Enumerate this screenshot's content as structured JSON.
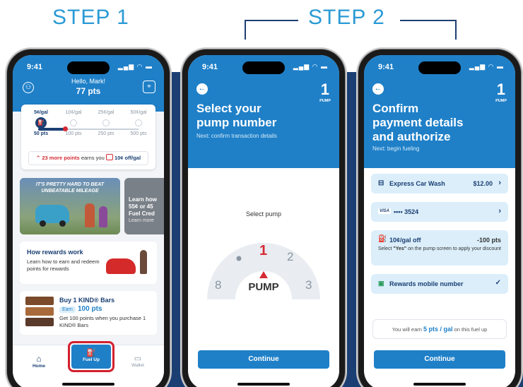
{
  "labels": {
    "step1": "STEP 1",
    "step2": "STEP 2"
  },
  "status_time": "9:41",
  "phone1": {
    "greeting": "Hello, Mark!",
    "points": "77 pts",
    "tiers": [
      {
        "rate": "5¢/gal",
        "pts": "50 pts"
      },
      {
        "rate": "10¢/gal",
        "pts": "100 pts"
      },
      {
        "rate": "25¢/gal",
        "pts": "250 pts"
      },
      {
        "rate": "50¢/gal",
        "pts": "500 pts"
      }
    ],
    "progress_fraction": 0.27,
    "more_points": "23 more points",
    "earns_you": "earns you",
    "reward": "10¢ off/gal",
    "promo_headline_1": "IT'S PRETTY HARD TO BEAT",
    "promo_headline_2": "UNBEATABLE MILEAGE",
    "promo2_text_1": "Learn how",
    "promo2_text_2": "55¢ or 45",
    "promo2_text_3": "Fuel Cred",
    "promo2_text_4": "Learn more",
    "rewards_title": "How rewards work",
    "rewards_desc": "Learn how to earn and redeem points for rewards",
    "kind_title": "Buy 1 KIND® Bars",
    "kind_earn": "Earn",
    "kind_pts": "100 pts",
    "kind_desc": "Get 100 points when you purchase 1 KIND® Bars",
    "nav": {
      "home": "Home",
      "fuel": "Fuel Up",
      "wallet": "Wallet"
    }
  },
  "phone2": {
    "pump_num": "1",
    "pump_label": "PUMP",
    "title_1": "Select your",
    "title_2": "pump number",
    "subtitle": "Next: confirm transaction details",
    "select_pump": "Select pump",
    "dial": {
      "left": "8",
      "current": "1",
      "right2": "2",
      "right3": "3",
      "label": "PUMP"
    },
    "continue": "Continue"
  },
  "phone3": {
    "pump_num": "1",
    "pump_label": "PUMP",
    "title_1": "Confirm",
    "title_2": "payment details",
    "title_3": "and authorize",
    "subtitle": "Next: begin fueling",
    "carwash": "Express Car Wash",
    "carwash_price": "$12.00",
    "card_brand": "VISA",
    "card_num": "•••• 3524",
    "discount": "10¢/gal off",
    "discount_pts": "-100 pts",
    "discount_note_pre": "Select ",
    "discount_note_yes": "\"Yes\"",
    "discount_note_post": " on the pump screen to apply your discount",
    "rewards_mobile": "Rewards mobile number",
    "earn_pre": "You will earn ",
    "earn_value": "5 pts / gal",
    "earn_post": " on this fuel up",
    "continue": "Continue"
  }
}
